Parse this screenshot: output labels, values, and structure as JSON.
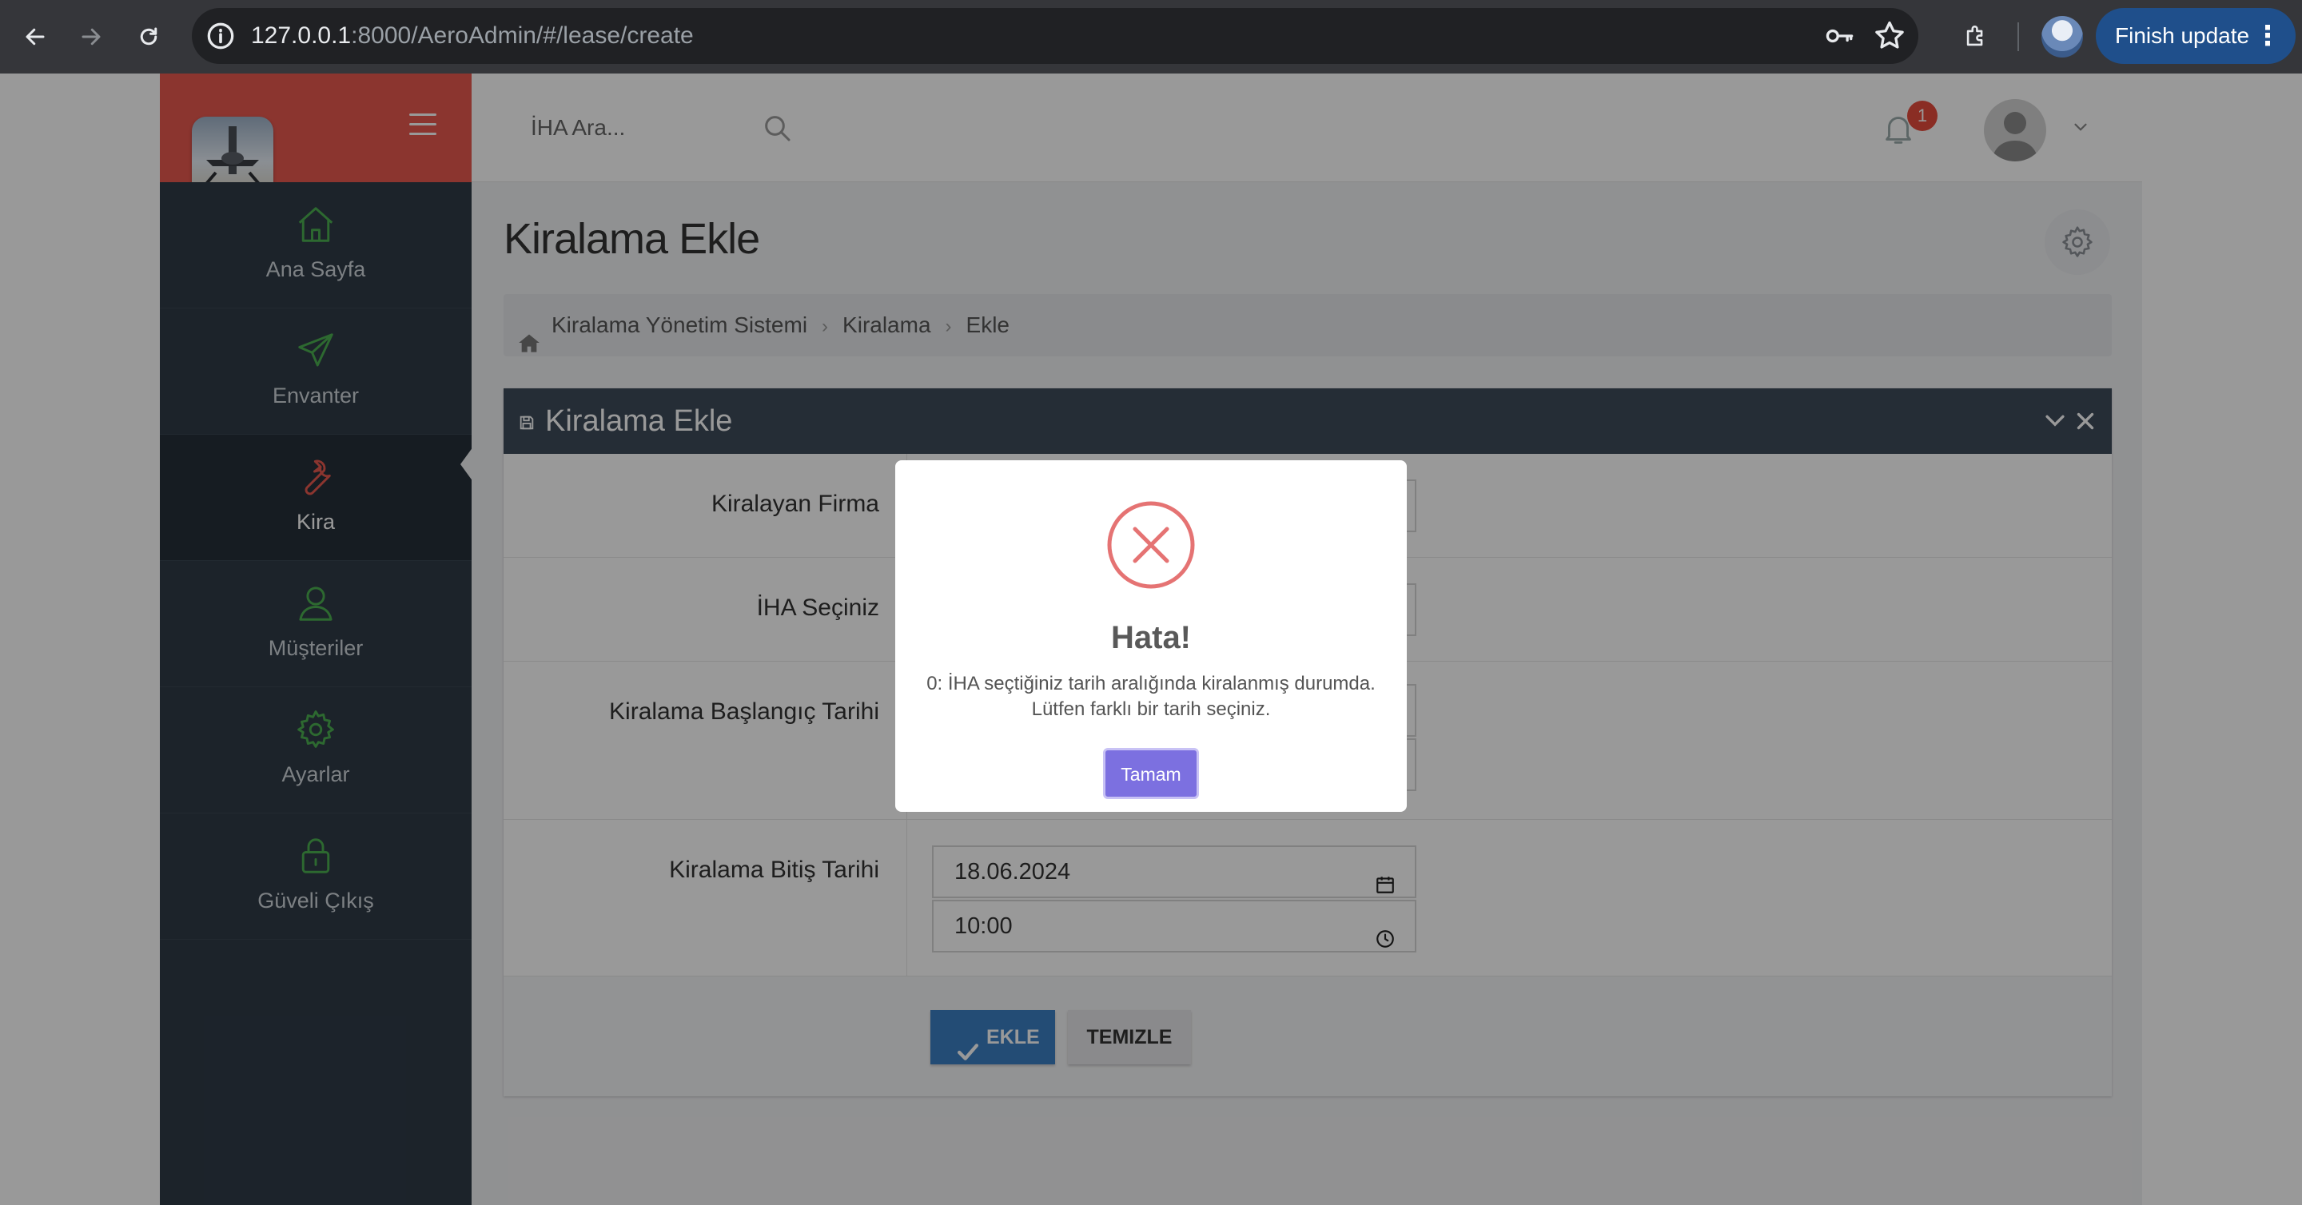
{
  "browser": {
    "url_host": "127.0.0.1",
    "url_rest": ":8000/AeroAdmin/#/lease/create",
    "finish_update_label": "Finish update",
    "icons": [
      "back-icon",
      "forward-icon",
      "reload-icon",
      "site-info-icon",
      "password-key-icon",
      "bookmark-star-icon",
      "extensions-icon",
      "profile-avatar",
      "more-menu-icon"
    ]
  },
  "header": {
    "search_placeholder": "İHA Ara...",
    "notification_count": "1"
  },
  "sidebar": {
    "items": [
      {
        "label": "Ana Sayfa",
        "icon": "home-icon"
      },
      {
        "label": "Envanter",
        "icon": "send-icon"
      },
      {
        "label": "Kira",
        "icon": "wrench-icon",
        "active": true
      },
      {
        "label": "Müşteriler",
        "icon": "user-icon"
      },
      {
        "label": "Ayarlar",
        "icon": "gear-icon"
      },
      {
        "label": "Güveli Çıkış",
        "icon": "lock-icon"
      }
    ]
  },
  "main": {
    "page_title": "Kiralama Ekle",
    "breadcrumb": [
      "Kiralama Yönetim Sistemi",
      "Kiralama",
      "Ekle"
    ],
    "panel_title": "Kiralama Ekle",
    "form": {
      "company_label": "Kiralayan Firma",
      "uav_label": "İHA Seçiniz",
      "start_label": "Kiralama Başlangıç Tarihi",
      "end_label": "Kiralama Bitiş Tarihi",
      "end_date": "18.06.2024",
      "end_time": "10:00"
    },
    "buttons": {
      "add": "EKLE",
      "clear": "TEMIZLE"
    }
  },
  "modal": {
    "title": "Hata!",
    "message": "0: İHA seçtiğiniz tarih aralığında kiralanmış durumda. Lütfen farklı bir tarih seçiniz.",
    "confirm": "Tamam"
  },
  "colors": {
    "logo_bg": "#e8594f",
    "sidebar_bg": "#2f3b47",
    "panel_header": "#3f4b5b",
    "primary_button": "#3b7fc4",
    "modal_button": "#7c70e0",
    "error_red": "#e57373",
    "icon_green": "#4caf50"
  }
}
